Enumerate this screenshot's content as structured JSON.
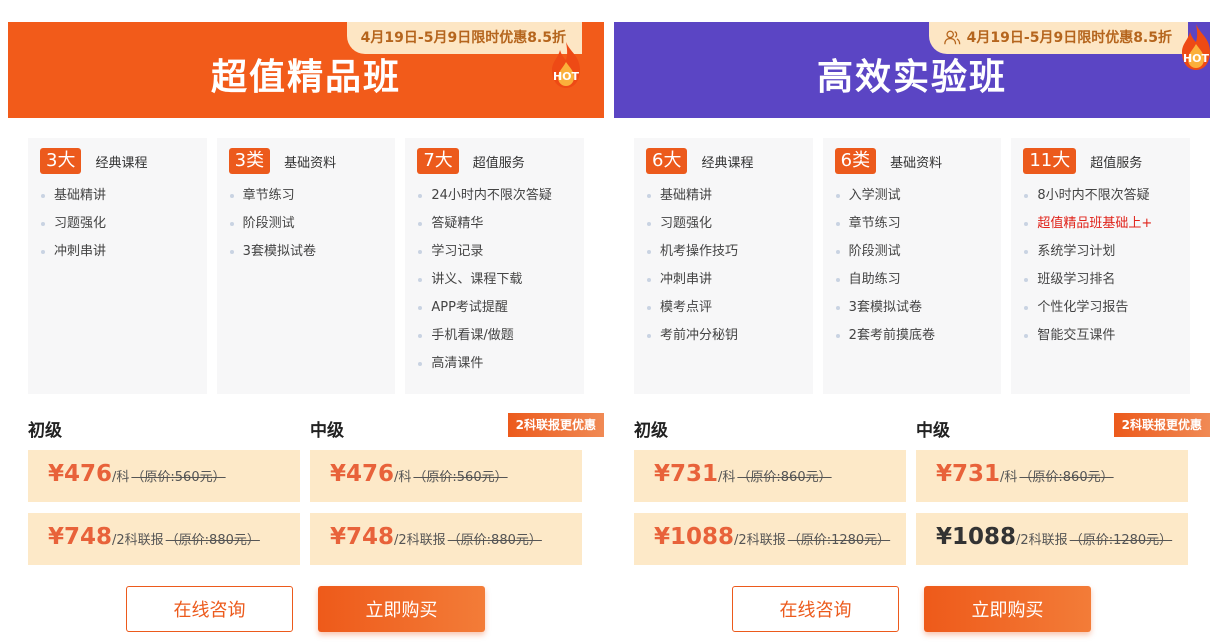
{
  "cards": [
    {
      "title": "超值精品班",
      "promo": "4月19日-5月9日限时优惠8.5折",
      "hot": "HOT",
      "columns": [
        {
          "badge": "3大",
          "title": "经典课程",
          "items": [
            "基础精讲",
            "习题强化",
            "冲刺串讲"
          ]
        },
        {
          "badge": "3类",
          "title": "基础资料",
          "items": [
            "章节练习",
            "阶段测试",
            "3套模拟试卷"
          ]
        },
        {
          "badge": "7大",
          "title": "超值服务",
          "items": [
            "24小时内不限次答疑",
            "答疑精华",
            "学习记录",
            "讲义、课程下载",
            "APP考试提醒",
            "手机看课/做题",
            "高清课件"
          ]
        }
      ],
      "levels": [
        "初级",
        "中级"
      ],
      "combo_tag": "2科联报更优惠",
      "prices": [
        {
          "amount": "¥476",
          "unit": "/科",
          "original": "（原价:560元）"
        },
        {
          "amount": "¥476",
          "unit": "/科",
          "original": "（原价:560元）"
        },
        {
          "amount": "¥748",
          "unit": "/2科联报",
          "original": "（原价:880元）"
        },
        {
          "amount": "¥748",
          "unit": "/2科联报",
          "original": "（原价:880元）"
        }
      ],
      "consult_label": "在线咨询",
      "buy_label": "立即购买"
    },
    {
      "title": "高效实验班",
      "promo": "4月19日-5月9日限时优惠8.5折",
      "hot": "HOT",
      "columns": [
        {
          "badge": "6大",
          "title": "经典课程",
          "items": [
            "基础精讲",
            "习题强化",
            "机考操作技巧",
            "冲刺串讲",
            "模考点评",
            "考前冲分秘钥"
          ]
        },
        {
          "badge": "6类",
          "title": "基础资料",
          "items": [
            "入学测试",
            "章节练习",
            "阶段测试",
            "自助练习",
            "3套模拟试卷",
            "2套考前摸底卷"
          ]
        },
        {
          "badge": "11大",
          "title": "超值服务",
          "items": [
            "8小时内不限次答疑",
            "超值精品班基础上+",
            "系统学习计划",
            "班级学习排名",
            "个性化学习报告",
            "智能交互课件"
          ]
        }
      ],
      "levels": [
        "初级",
        "中级"
      ],
      "combo_tag": "2科联报更优惠",
      "prices": [
        {
          "amount": "¥731",
          "unit": "/科",
          "original": "（原价:860元）"
        },
        {
          "amount": "¥731",
          "unit": "/科",
          "original": "（原价:860元）"
        },
        {
          "amount": "¥1088",
          "unit": "/2科联报",
          "original": "（原价:1280元）"
        },
        {
          "amount": "¥1088",
          "unit": "/2科联报",
          "original": "（原价:1280元）"
        }
      ],
      "consult_label": "在线咨询",
      "buy_label": "立即购买"
    }
  ],
  "colors": {
    "orange_header": "#f25b1a",
    "purple_header": "#5b45c4",
    "accent": "#ec5a1c",
    "price_bg": "#fde9c8",
    "promo_bg": "#fde6c4",
    "highlight_text": "#e0231a"
  },
  "icons": {
    "hot": "flame-hot-icon",
    "user": "user-group-icon"
  }
}
